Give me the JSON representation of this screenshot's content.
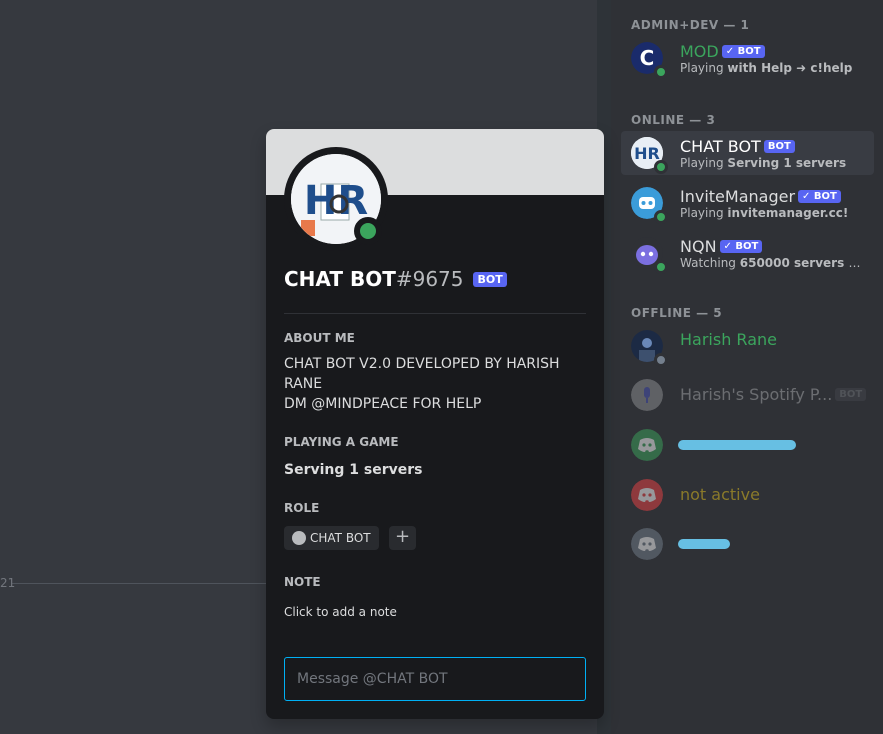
{
  "chat": {
    "divider_text": "21"
  },
  "members": {
    "sections": [
      {
        "label": "ADMIN+DEV — 1"
      },
      {
        "label": "ONLINE — 3"
      },
      {
        "label": "OFFLINE — 5"
      }
    ],
    "admin": [
      {
        "name": "MOD",
        "badge": "✓ BOT",
        "activity_prefix": "Playing",
        "activity": "with Help ➜ c!help",
        "name_color": "#3ba55d"
      }
    ],
    "online": [
      {
        "name": "CHAT BOT",
        "badge": "BOT",
        "activity_prefix": "Playing",
        "activity": "Serving 1 servers"
      },
      {
        "name": "InviteManager",
        "badge": "✓ BOT",
        "activity_prefix": "Playing",
        "activity": "invitemanager.cc!"
      },
      {
        "name": "NQN",
        "badge": "✓ BOT",
        "activity_prefix": "Watching",
        "activity": "650000 servers an..."
      }
    ],
    "offline": [
      {
        "name": "Harish Rane",
        "name_color": "#3ba55d"
      },
      {
        "name": "Harish's Spotify P...",
        "badge": "BOT"
      },
      {
        "name": ""
      },
      {
        "name": "not active",
        "name_color": "#8a7a2a"
      },
      {
        "name": ""
      }
    ]
  },
  "popout": {
    "username": "CHAT BOT",
    "discriminator": "#9675",
    "badge": "BOT",
    "about_heading": "ABOUT ME",
    "about_line1": "CHAT BOT V2.0 DEVELOPED BY HARISH",
    "about_line2": "RANE",
    "about_line3": "DM @MINDPEACE FOR HELP",
    "game_heading": "PLAYING A GAME",
    "game_value": "Serving 1 servers",
    "role_heading": "ROLE",
    "role_name": "CHAT BOT",
    "add_role": "+",
    "note_heading": "NOTE",
    "note_placeholder": "Click to add a note",
    "message_placeholder": "Message @CHAT BOT"
  },
  "colors": {
    "accent": "#5865f2",
    "online": "#3ba55d",
    "focus": "#00b0f4"
  }
}
